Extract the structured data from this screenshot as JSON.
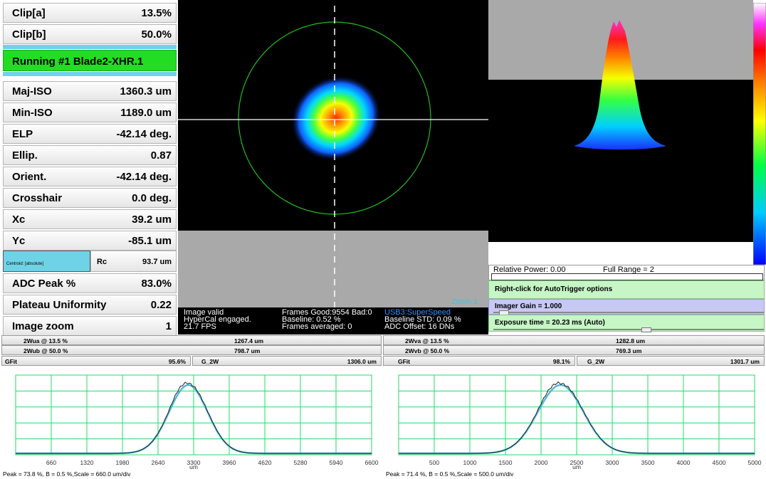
{
  "metrics": [
    {
      "label": "Clip[a]",
      "value": "13.5%"
    },
    {
      "label": "Clip[b]",
      "value": "50.0%"
    }
  ],
  "running": "Running #1 Blade2-XHR.1",
  "metrics2": [
    {
      "label": "Maj-ISO",
      "value": "1360.3 um"
    },
    {
      "label": "Min-ISO",
      "value": "1189.0 um"
    },
    {
      "label": "ELP",
      "value": "-42.14 deg."
    },
    {
      "label": "Ellip.",
      "value": "0.87"
    },
    {
      "label": "Orient.",
      "value": "-42.14 deg."
    },
    {
      "label": "Crosshair",
      "value": "0.0 deg."
    },
    {
      "label": "Xc",
      "value": "39.2 um"
    },
    {
      "label": "Yc",
      "value": "-85.1 um"
    }
  ],
  "centroid": {
    "label": "Centroid: [absolute]",
    "rc_label": "Rc",
    "rc_value": "93.7 um"
  },
  "metrics3": [
    {
      "label": "ADC Peak %",
      "value": "83.0%"
    },
    {
      "label": "Plateau Uniformity",
      "value": "0.22"
    },
    {
      "label": "Image zoom",
      "value": "1"
    }
  ],
  "status": {
    "image_valid": "Image valid",
    "hypercal": "HyperCal engaged.",
    "fps": "21.7 FPS",
    "frames": "Frames Good:9554 Bad:0",
    "baseline": "Baseline: 0.52 %",
    "frames_avg": "Frames averaged: 0",
    "usb": "USB3:SuperSpeed",
    "baseline_std": "Baseline STD:  0.09 %",
    "adc_offset": "ADC Offset: 16 DNs",
    "zoom": "Zoom 1"
  },
  "controls": {
    "relative_power": "Relative Power: 0.00",
    "full_range": "Full Range = 2",
    "autotrigger": "Right-click for AutoTrigger options",
    "gain": "Imager Gain = 1.000",
    "exposure": "Exposure time = 20.23 ms (Auto)"
  },
  "measurements": {
    "u": [
      {
        "label": "2Wua @ 13.5 %",
        "value": "1267.4 um"
      },
      {
        "label": "2Wub @ 50.0 %",
        "value": "798.7 um"
      }
    ],
    "v": [
      {
        "label": "2Wva @ 13.5 %",
        "value": "1282.8 um"
      },
      {
        "label": "2Wvb @ 50.0 %",
        "value": "769.3 um"
      }
    ],
    "gfit_u": {
      "label": "GFit",
      "value": "95.6%",
      "g2w_label": "G_2W",
      "g2w_value": "1306.0 um"
    },
    "gfit_v": {
      "label": "GFit",
      "value": "98.1%",
      "g2w_label": "G_2W",
      "g2w_value": "1301.7 um"
    }
  },
  "plots": {
    "unit": "um",
    "left_ticks": [
      "660",
      "1320",
      "1980",
      "2640",
      "3300",
      "3960",
      "4620",
      "5280",
      "5940",
      "6600"
    ],
    "right_ticks": [
      "500",
      "1000",
      "1500",
      "2000",
      "2500",
      "3000",
      "3500",
      "4000",
      "4500",
      "5000"
    ],
    "left_footer": "Peak = 73.8 %, B = 0.5 %,Scale = 660.0 um/div",
    "right_footer": "Peak = 71.4 %, B = 0.5 %,Scale = 500.0 um/div"
  },
  "colors": {
    "running_bg": "#22dd22",
    "cyan": "#6fd3e8",
    "control_green": "#c6f5c6",
    "gain_bg": "#c8c8f5",
    "grid": "#22dd66",
    "fit": "#4fb8d8"
  }
}
